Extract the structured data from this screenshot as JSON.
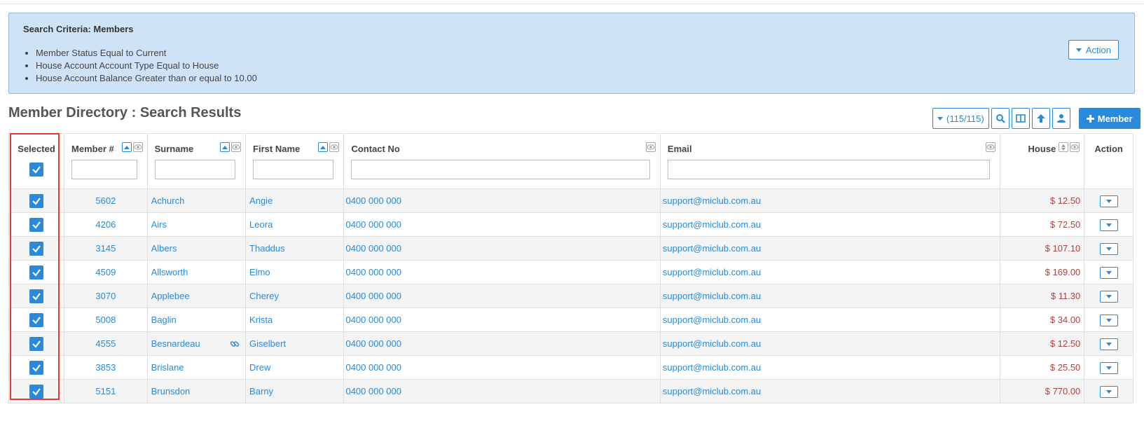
{
  "criteria": {
    "title": "Search Criteria: Members",
    "items": [
      "Member Status Equal to Current",
      "House Account Account Type Equal to House",
      "House Account Balance Greater than or equal to 10.00"
    ],
    "action_label": "Action"
  },
  "page": {
    "title": "Member Directory : Search Results"
  },
  "toolbar": {
    "count": "(115/115)",
    "add_member_label": "Member"
  },
  "columns": {
    "selected": "Selected",
    "member_no": "Member #",
    "surname": "Surname",
    "first_name": "First Name",
    "contact_no": "Contact No",
    "email": "Email",
    "house": "House",
    "action": "Action"
  },
  "rows": [
    {
      "member": "5602",
      "surname": "Achurch",
      "first": "Angie",
      "contact": "0400 000 000",
      "email": "support@miclub.com.au",
      "house": "$ 12.50"
    },
    {
      "member": "4206",
      "surname": "Airs",
      "first": "Leora",
      "contact": "0400 000 000",
      "email": "support@miclub.com.au",
      "house": "$ 72.50"
    },
    {
      "member": "3145",
      "surname": "Albers",
      "first": "Thaddus",
      "contact": "0400 000 000",
      "email": "support@miclub.com.au",
      "house": "$ 107.10"
    },
    {
      "member": "4509",
      "surname": "Allsworth",
      "first": "Elmo",
      "contact": "0400 000 000",
      "email": "support@miclub.com.au",
      "house": "$ 169.00"
    },
    {
      "member": "3070",
      "surname": "Applebee",
      "first": "Cherey",
      "contact": "0400 000 000",
      "email": "support@miclub.com.au",
      "house": "$ 11.30"
    },
    {
      "member": "5008",
      "surname": "Baglin",
      "first": "Krista",
      "contact": "0400 000 000",
      "email": "support@miclub.com.au",
      "house": "$ 34.00"
    },
    {
      "member": "4555",
      "surname": "Besnardeau",
      "first": "Giselbert",
      "contact": "0400 000 000",
      "email": "support@miclub.com.au",
      "house": "$ 12.50",
      "linked": true
    },
    {
      "member": "3853",
      "surname": "Brislane",
      "first": "Drew",
      "contact": "0400 000 000",
      "email": "support@miclub.com.au",
      "house": "$ 25.50"
    },
    {
      "member": "5151",
      "surname": "Brunsdon",
      "first": "Barny",
      "contact": "0400 000 000",
      "email": "support@miclub.com.au",
      "house": "$ 770.00"
    }
  ],
  "icons": {
    "checkbox": "check-icon",
    "sort": "sort-asc-icon",
    "visibility": "eye-icon",
    "search": "search-icon",
    "columns": "columns-icon",
    "upload": "arrow-up-icon",
    "user": "user-icon",
    "plus": "plus-icon",
    "link": "link-icon"
  },
  "colors": {
    "accent": "#2a8ad9",
    "criteria_bg": "#cfe3f6",
    "amount": "#a94442",
    "highlight": "#e53935"
  }
}
